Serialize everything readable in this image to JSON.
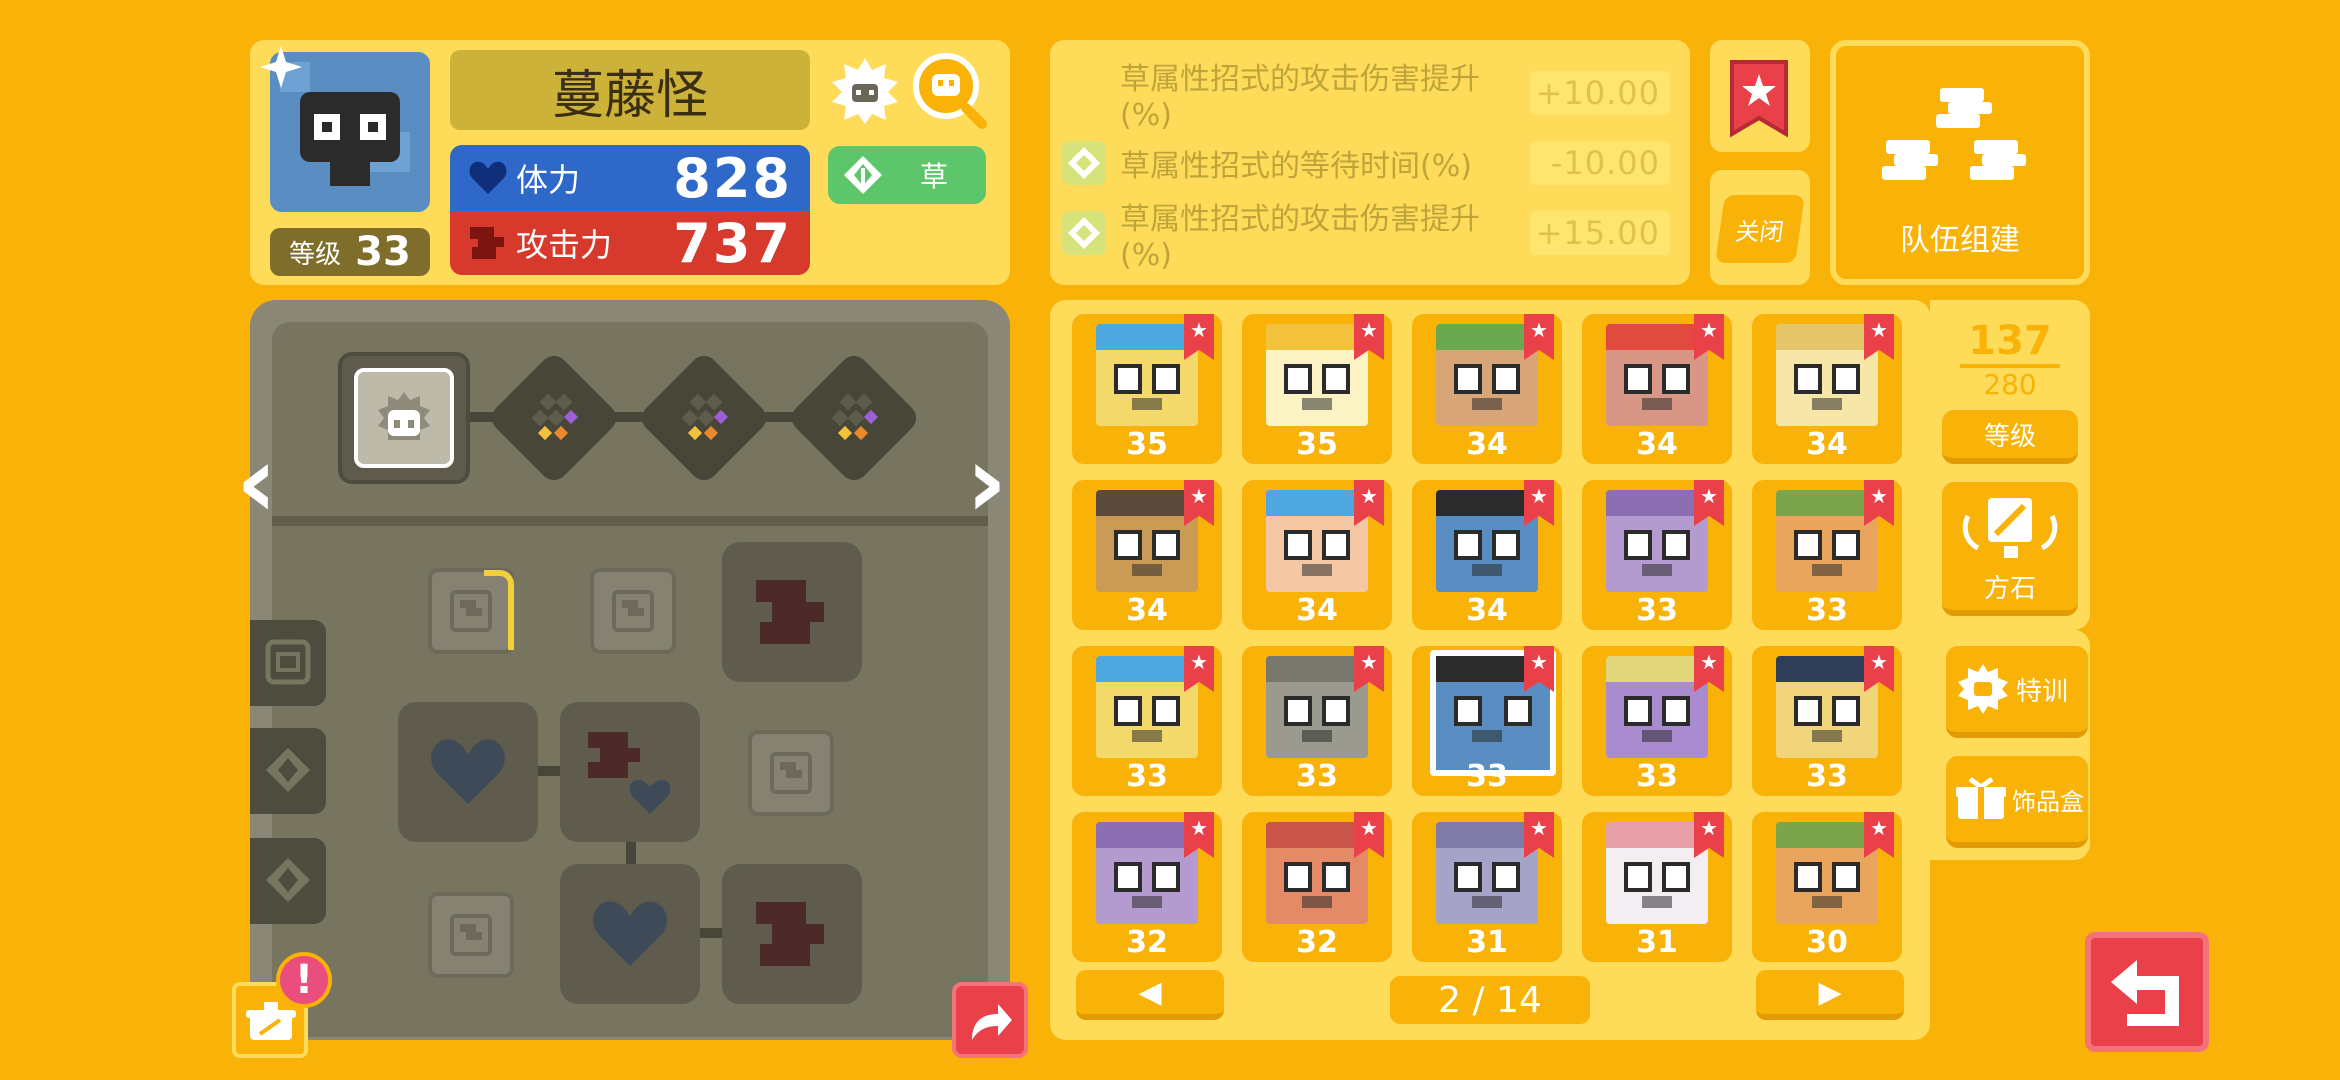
{
  "pokemon": {
    "name": "蔓藤怪",
    "level_label": "等级",
    "level": "33",
    "hp_label": "体力",
    "hp": "828",
    "attack_label": "攻击力",
    "attack": "737",
    "type": "草"
  },
  "bonuses": [
    {
      "text": "草属性招式的攻击伤害提升(%)",
      "value": "+10.00"
    },
    {
      "text": "草属性招式的等待时间(%)",
      "value": "-10.00"
    },
    {
      "text": "草属性招式的攻击伤害提升(%)",
      "value": "+15.00"
    }
  ],
  "buttons": {
    "close": "关闭",
    "team_build": "队伍组建",
    "sort_level": "等级",
    "stones": "方石",
    "training": "特训",
    "decor_box": "饰品盒",
    "prev_page": "◀",
    "next_page": "▶",
    "nav_left": "‹",
    "nav_right": "›",
    "alert": "!"
  },
  "box": {
    "count": "137",
    "capacity": "280",
    "page": "2 / 14"
  },
  "roster": [
    {
      "level": "35",
      "color": "#F3D96A",
      "accent": "#4FA7E0",
      "icon": "pokemon-face-icon"
    },
    {
      "level": "35",
      "color": "#FBF3C4",
      "accent": "#F2C23C",
      "icon": "pokemon-face-icon"
    },
    {
      "level": "34",
      "color": "#D7A577",
      "accent": "#6CA850",
      "icon": "pokemon-face-icon"
    },
    {
      "level": "34",
      "color": "#D89686",
      "accent": "#E14B3F",
      "icon": "pokemon-face-icon"
    },
    {
      "level": "34",
      "color": "#F6E7A8",
      "accent": "#E5C56A",
      "icon": "pokemon-face-icon"
    },
    {
      "level": "34",
      "color": "#C99B55",
      "accent": "#5A4B3C",
      "icon": "pokemon-face-icon"
    },
    {
      "level": "34",
      "color": "#F4C7A4",
      "accent": "#4FA7E0",
      "icon": "pokemon-face-icon"
    },
    {
      "level": "34",
      "color": "#5A8EC2",
      "accent": "#2B2B2B",
      "icon": "pokemon-face-icon"
    },
    {
      "level": "33",
      "color": "#B39ACF",
      "accent": "#8C6FB2",
      "icon": "pokemon-face-icon"
    },
    {
      "level": "33",
      "color": "#E9A45E",
      "accent": "#7BA54A",
      "icon": "pokemon-face-icon"
    },
    {
      "level": "33",
      "color": "#F3D96A",
      "accent": "#4FA7E0",
      "icon": "pokemon-face-icon"
    },
    {
      "level": "33",
      "color": "#9A9A8E",
      "accent": "#77776C",
      "icon": "pokemon-face-icon"
    },
    {
      "level": "33",
      "color": "#5A8EC2",
      "accent": "#2B2B2B",
      "icon": "pokemon-face-icon",
      "selected": true
    },
    {
      "level": "33",
      "color": "#A98BD0",
      "accent": "#E2D67A",
      "icon": "pokemon-face-icon"
    },
    {
      "level": "33",
      "color": "#F1D57A",
      "accent": "#2E3E58",
      "icon": "pokemon-face-icon"
    },
    {
      "level": "32",
      "color": "#B39ACF",
      "accent": "#8C6FB2",
      "icon": "pokemon-face-icon"
    },
    {
      "level": "32",
      "color": "#E48A67",
      "accent": "#C9554A",
      "icon": "pokemon-face-icon"
    },
    {
      "level": "31",
      "color": "#A6A3C9",
      "accent": "#7F7AA8",
      "icon": "pokemon-face-icon"
    },
    {
      "level": "31",
      "color": "#F2EEF2",
      "accent": "#E8A0A8",
      "icon": "pokemon-face-icon"
    },
    {
      "level": "30",
      "color": "#E9A45E",
      "accent": "#7BA54A",
      "icon": "pokemon-face-icon"
    }
  ],
  "colors": {
    "background": "#F8B208",
    "panel": "#FEDC5A",
    "hp": "#2E68C8",
    "attack": "#D7392C",
    "grass": "#5DC56A",
    "bookmark": "#E9404A"
  }
}
